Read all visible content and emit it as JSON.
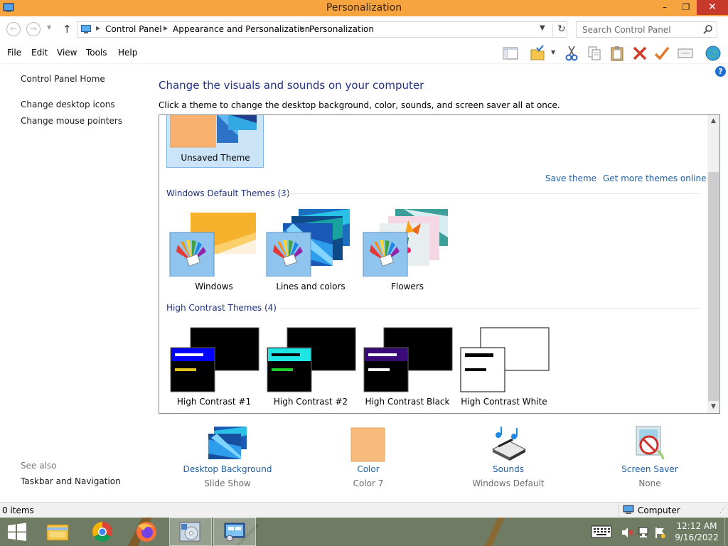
{
  "window": {
    "title": "Personalization",
    "controls": {
      "minimize": "–",
      "maximize": "❐",
      "close": "✕"
    }
  },
  "address": {
    "crumbs": [
      "Control Panel",
      "Appearance and Personalization",
      "Personalization"
    ],
    "search_placeholder": "Search Control Panel"
  },
  "menu": [
    "File",
    "Edit",
    "View",
    "Tools",
    "Help"
  ],
  "help_icon": "?",
  "left_panel": {
    "home": "Control Panel Home",
    "links": [
      "Change desktop icons",
      "Change mouse pointers"
    ],
    "see_also_title": "See also",
    "see_also_links": [
      "Taskbar and Navigation"
    ]
  },
  "main": {
    "heading": "Change the visuals and sounds on your computer",
    "subtext": "Click a theme to change the desktop background, color, sounds, and screen saver all at once.",
    "my_themes": {
      "items": [
        {
          "label": "Unsaved Theme",
          "selected": true
        }
      ]
    },
    "save_theme": "Save theme",
    "get_more_themes": "Get more themes online",
    "default_section": {
      "title": "Windows Default Themes (3)",
      "items": [
        {
          "label": "Windows"
        },
        {
          "label": "Lines and colors"
        },
        {
          "label": "Flowers"
        }
      ]
    },
    "contrast_section": {
      "title": "High Contrast Themes (4)",
      "items": [
        {
          "label": "High Contrast #1"
        },
        {
          "label": "High Contrast #2"
        },
        {
          "label": "High Contrast Black"
        },
        {
          "label": "High Contrast White"
        }
      ]
    }
  },
  "bottom": [
    {
      "label": "Desktop Background",
      "value": "Slide Show"
    },
    {
      "label": "Color",
      "value": "Color 7"
    },
    {
      "label": "Sounds",
      "value": "Windows Default"
    },
    {
      "label": "Screen Saver",
      "value": "None"
    }
  ],
  "status": {
    "items": "0 items",
    "location": "Computer"
  },
  "taskbar": {
    "time": "12:12 AM",
    "date": "9/16/2022"
  },
  "colors": {
    "title_bar": "#f5a43f",
    "link": "#1e5fa6",
    "heading": "#1e3287",
    "selected_bg": "#cce4f7",
    "taskbar": "#6f7c63",
    "color_swatch": "#f7bc7c"
  }
}
